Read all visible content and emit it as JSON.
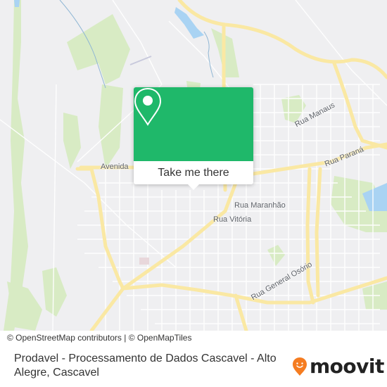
{
  "map": {
    "road_labels": [
      {
        "name": "Rua Manaus"
      },
      {
        "name": "Rua Paraná"
      },
      {
        "name": "Rua Maranhão"
      },
      {
        "name": "Rua Vitória"
      },
      {
        "name": "Rua General Osório"
      },
      {
        "name": "Avenida"
      }
    ],
    "colors": {
      "background": "#efeff1",
      "major_road": "#fae8a3",
      "minor_road": "#ffffff",
      "park": "#d8ebc4",
      "water": "#a9d3f3"
    }
  },
  "attribution": "© OpenStreetMap contributors | © OpenMapTiles",
  "popup": {
    "button_label": "Take me there",
    "accent_color": "#1fb86a",
    "icon": "map-pin-icon"
  },
  "footer": {
    "title": "Prodavel - Processamento de Dados Cascavel - Alto Alegre, Cascavel",
    "brand": "moovit",
    "brand_color": "#f57c20"
  }
}
